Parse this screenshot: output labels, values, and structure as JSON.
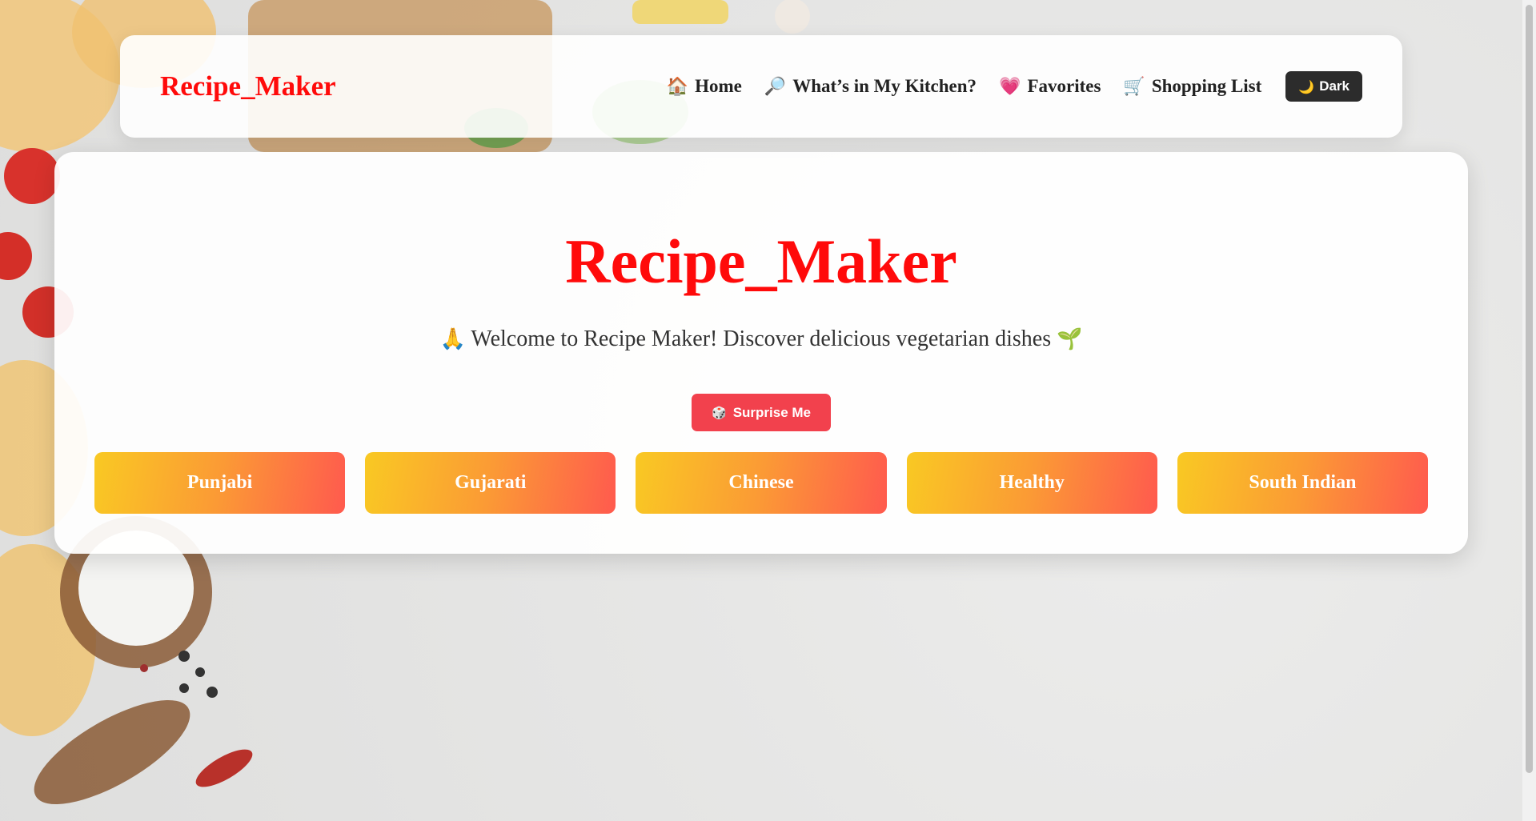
{
  "navbar": {
    "brand": "Recipe_Maker",
    "links": [
      {
        "icon": "🏠",
        "icon_name": "house-icon",
        "label": "Home"
      },
      {
        "icon": "🔎",
        "icon_name": "magnifier-icon",
        "label": "What’s in My Kitchen?"
      },
      {
        "icon": "💗",
        "icon_name": "heart-icon",
        "label": "Favorites"
      },
      {
        "icon": "🛒",
        "icon_name": "cart-icon",
        "label": "Shopping List"
      }
    ],
    "theme_toggle": {
      "icon": "🌙",
      "icon_name": "moon-icon",
      "label": "Dark"
    }
  },
  "hero": {
    "title": "Recipe_Maker",
    "subtitle_prefix_icon": "🙏",
    "subtitle": "Welcome to Recipe Maker! Discover delicious vegetarian dishes",
    "subtitle_suffix_icon": "🌱",
    "surprise_button": {
      "icon": "🎲",
      "icon_name": "dice-icon",
      "label": "Surprise Me"
    },
    "categories": [
      "Punjabi",
      "Gujarati",
      "Chinese",
      "Healthy",
      "South Indian"
    ]
  },
  "colors": {
    "brand_red": "#ff0a0a",
    "surprise_button": "#f2414d",
    "category_gradient_start": "#f9c923",
    "category_gradient_end": "#ff5a4e",
    "dark_button": "#2c2c2c"
  }
}
